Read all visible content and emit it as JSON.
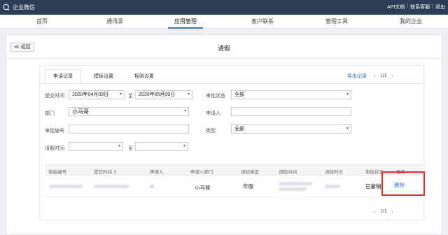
{
  "app": {
    "brand": "企业微信",
    "top_links": [
      "API文档",
      "联系客服",
      "退出"
    ]
  },
  "nav": {
    "items": [
      "首页",
      "通讯录",
      "应用管理",
      "客户联系",
      "管理工具",
      "我的企业"
    ],
    "active": "应用管理"
  },
  "panel": {
    "back_label": "≪ 返回",
    "title": "请假"
  },
  "tabs": {
    "items": [
      "申请记录",
      "模板设置",
      "规则设置"
    ],
    "active": "申请记录"
  },
  "toolbar": {
    "export_label": "导出记录",
    "pager_text": "1/1"
  },
  "filters": {
    "submit_time_label": "提交时间",
    "submit_from": "2020年04月09日",
    "submit_to": "2020年05月09日",
    "to_label": "至",
    "status_label": "审批状态",
    "status_value": "全部",
    "dept_label": "部门",
    "dept_value": "小马哥",
    "applicant_label": "申请人",
    "applicant_value": "",
    "number_label": "审批编号",
    "number_value": "",
    "type_label": "类型",
    "type_value": "全部",
    "leave_time_label": "请假时间",
    "leave_from": "",
    "leave_to": ""
  },
  "table": {
    "headers": [
      "审批编号",
      "提交时间 ⇕",
      "申请人",
      "申请人部门",
      "请假类型",
      "请假时间",
      "请假时长",
      "审批状态",
      "操作"
    ],
    "rows": [
      {
        "dept": "小马哥",
        "leave_type": "年假",
        "status": "已撤销",
        "action": "删除"
      }
    ]
  },
  "footer_pager": {
    "text": "1/1"
  },
  "colors": {
    "topbar": "#2c3e57",
    "accent": "#3d77c9",
    "link": "#2e6fc7",
    "highlight": "#e0302a"
  }
}
